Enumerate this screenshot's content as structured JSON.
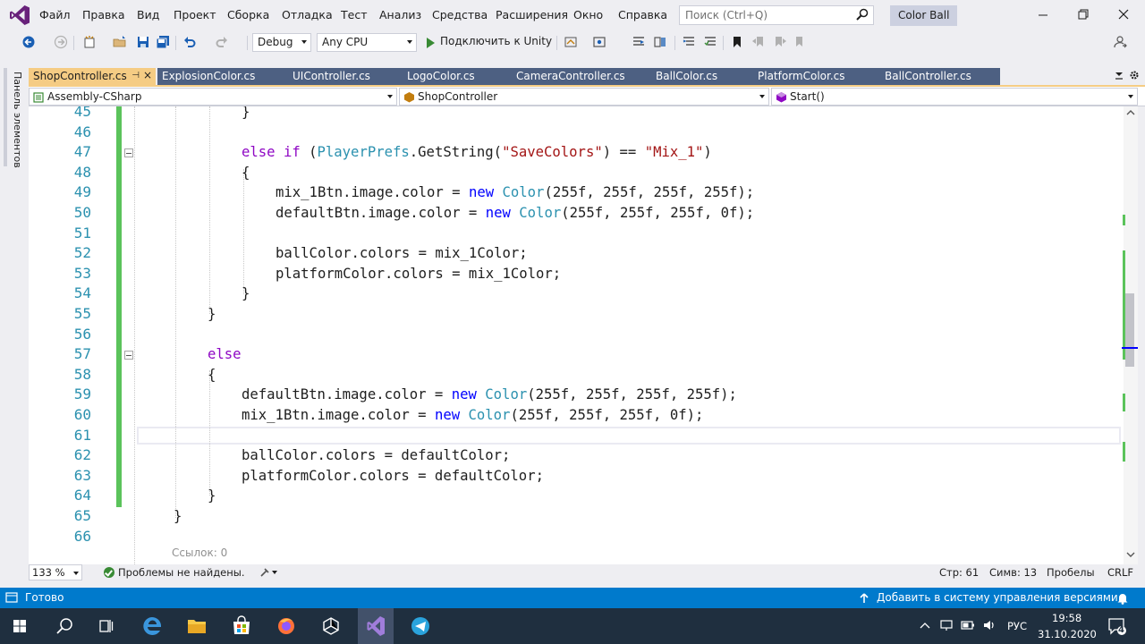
{
  "menu": [
    "Файл",
    "Правка",
    "Вид",
    "Проект",
    "Сборка",
    "Отладка",
    "Тест",
    "Анализ",
    "Средства",
    "Расширения",
    "Окно",
    "Справка"
  ],
  "search": {
    "placeholder": "Поиск (Ctrl+Q)"
  },
  "project_title": "Color Ball",
  "toolbar": {
    "config": "Debug",
    "platform": "Any CPU",
    "run_label": "Подключить к Unity"
  },
  "side_panel": {
    "label": "Панель элементов"
  },
  "tabs": [
    {
      "label": "ShopController.cs",
      "active": true
    },
    {
      "label": "ExplosionColor.cs",
      "active": false
    },
    {
      "label": "UIController.cs",
      "active": false
    },
    {
      "label": "LogoColor.cs",
      "active": false
    },
    {
      "label": "CameraController.cs",
      "active": false
    },
    {
      "label": "BallColor.cs",
      "active": false
    },
    {
      "label": "PlatformColor.cs",
      "active": false
    },
    {
      "label": "BallController.cs",
      "active": false
    }
  ],
  "nav": {
    "assembly": "Assembly-CSharp",
    "class": "ShopController",
    "member": "Start()"
  },
  "code": {
    "line_numbers": [
      "45",
      "46",
      "47",
      "48",
      "49",
      "50",
      "51",
      "52",
      "53",
      "54",
      "55",
      "56",
      "57",
      "58",
      "59",
      "60",
      "61",
      "62",
      "63",
      "64",
      "65",
      "66"
    ],
    "l45": "}",
    "l47_a": "else if",
    "l47_b": " (",
    "l47_c": "PlayerPrefs",
    "l47_d": ".",
    "l47_e": "GetString",
    "l47_f": "(",
    "l47_g": "\"SaveColors\"",
    "l47_h": ") == ",
    "l47_i": "\"Mix_1\"",
    "l47_j": ")",
    "l48": "{",
    "l49_a": "mix_1Btn.image.color = ",
    "l49_b": "new",
    "l49_c": " ",
    "l49_d": "Color",
    "l49_e": "(255f, 255f, 255f, 255f);",
    "l50_a": "defaultBtn.image.color = ",
    "l50_b": "new",
    "l50_c": " ",
    "l50_d": "Color",
    "l50_e": "(255f, 255f, 255f, 0f);",
    "l52": "ballColor.colors = mix_1Color;",
    "l53": "platformColor.colors = mix_1Color;",
    "l54": "}",
    "l55": "}",
    "l57": "else",
    "l58": "{",
    "l59_a": "defaultBtn.image.color = ",
    "l59_b": "new",
    "l59_c": " ",
    "l59_d": "Color",
    "l59_e": "(255f, 255f, 255f, 255f);",
    "l60_a": "mix_1Btn.image.color = ",
    "l60_b": "new",
    "l60_c": " ",
    "l60_d": "Color",
    "l60_e": "(255f, 255f, 255f, 0f);",
    "l62": "ballColor.colors = defaultColor;",
    "l63": "platformColor.colors = defaultColor;",
    "l64": "}",
    "l65": "}",
    "codelens": "Ссылок: 0"
  },
  "editor_status": {
    "zoom": "133 %",
    "issues": "Проблемы не найдены.",
    "line": "Стр: 61",
    "col": "Симв: 13",
    "whitespace": "Пробелы",
    "eol": "CRLF"
  },
  "statusbar": {
    "ready": "Готово",
    "source_control": "Добавить в систему управления версиями"
  },
  "tray": {
    "lang": "РУС",
    "time": "19:58",
    "date": "31.10.2020",
    "notifications": "4"
  },
  "colors": {
    "accent": "#007acc",
    "active_tab": "#f5cc84",
    "inactive_tab": "#4d6082",
    "keyword": "#0000ff",
    "control_keyword": "#8f08c4",
    "type": "#2b91af",
    "string": "#a31515",
    "change_bar": "#5bc35b"
  }
}
